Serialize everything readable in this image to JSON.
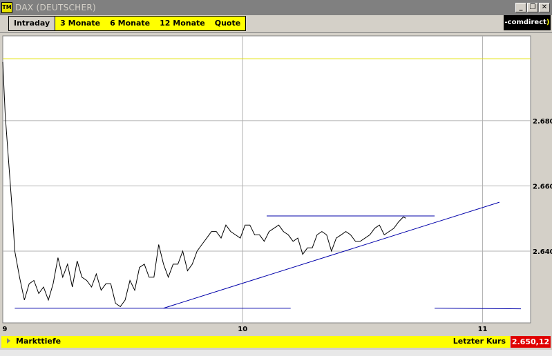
{
  "window": {
    "title": "DAX (DEUTSCHER)",
    "icon_label": "TM",
    "controls": [
      "_",
      "❐",
      "✕"
    ]
  },
  "tabs": [
    {
      "label": "Intraday",
      "active": true
    },
    {
      "label": "3 Monate",
      "active": false
    },
    {
      "label": "6 Monate",
      "active": false
    },
    {
      "label": "12 Monate",
      "active": false
    },
    {
      "label": "Quote",
      "active": false
    }
  ],
  "brand": {
    "name": "comdirect"
  },
  "footer": {
    "markttiefe_label": "Markttiefe",
    "last_price_label": "Letzter Kurs",
    "last_price_value": "2.650,12"
  },
  "colors": {
    "chart_background": "#ffffff",
    "grid": "#b0b0b0",
    "price_line": "#000000",
    "trend_lines": "#0000aa",
    "reference_line": "#e0e000",
    "tabs_yellow": "#ffff00",
    "last_price_red": "#e00000"
  },
  "chart_data": {
    "type": "line",
    "title": "",
    "xlabel": "",
    "ylabel": "",
    "x_ticks": [
      "9",
      "10",
      "11"
    ],
    "y_ticks": [
      "2.640",
      "2.660",
      "2.680"
    ],
    "xlim": [
      9.0,
      11.2
    ],
    "ylim": [
      2618,
      2706
    ],
    "grid": true,
    "y_axis_side": "right",
    "reference_line_y": 2699,
    "series": [
      {
        "x": [
          9.0,
          9.01,
          9.02,
          9.04,
          9.05,
          9.07,
          9.09,
          9.11,
          9.13,
          9.15,
          9.17,
          9.19,
          9.21,
          9.23,
          9.25,
          9.27,
          9.29,
          9.31,
          9.33,
          9.35,
          9.37,
          9.39,
          9.41,
          9.43,
          9.45,
          9.47,
          9.49,
          9.51,
          9.53,
          9.55,
          9.57,
          9.59,
          9.61,
          9.63,
          9.65,
          9.67,
          9.69,
          9.71,
          9.73,
          9.75,
          9.77,
          9.79,
          9.81,
          9.83,
          9.85,
          9.87,
          9.89,
          9.91,
          9.93,
          9.95,
          9.97,
          9.99,
          10.01,
          10.03,
          10.05,
          10.07,
          10.09,
          10.11,
          10.13,
          10.15,
          10.17,
          10.19,
          10.21,
          10.23,
          10.25,
          10.27,
          10.29,
          10.31,
          10.33,
          10.35,
          10.37,
          10.39,
          10.41,
          10.43,
          10.45,
          10.47,
          10.49,
          10.51,
          10.53,
          10.55,
          10.57,
          10.59,
          10.61,
          10.63,
          10.65,
          10.67,
          10.68
        ],
        "y": [
          2698,
          2682,
          2672,
          2652,
          2640,
          2632,
          2625,
          2630,
          2631,
          2627,
          2629,
          2625,
          2630,
          2638,
          2632,
          2636,
          2629,
          2637,
          2632,
          2631,
          2629,
          2633,
          2628,
          2630,
          2630,
          2624,
          2623,
          2625,
          2631,
          2628,
          2635,
          2636,
          2632,
          2632,
          2642,
          2636,
          2632,
          2636,
          2636,
          2640,
          2634,
          2636,
          2640,
          2642,
          2644,
          2646,
          2646,
          2644,
          2648,
          2646,
          2645,
          2644,
          2648,
          2648,
          2645,
          2645,
          2643,
          2646,
          2647,
          2648,
          2646,
          2645,
          2643,
          2644,
          2639,
          2641,
          2641,
          2645,
          2646,
          2645,
          2640,
          2644,
          2645,
          2646,
          2645,
          2643,
          2643,
          2644,
          2645,
          2647,
          2648,
          2645,
          2646,
          2647,
          2649,
          2650.5,
          2650.1
        ]
      }
    ],
    "trend_lines": [
      {
        "x": [
          9.05,
          10.2
        ],
        "y": [
          2622.5,
          2622.5
        ]
      },
      {
        "x": [
          9.67,
          11.07
        ],
        "y": [
          2622.5,
          2655
        ]
      },
      {
        "x": [
          10.1,
          10.8
        ],
        "y": [
          2650.8,
          2650.8
        ]
      },
      {
        "x": [
          10.8,
          11.16
        ],
        "y": [
          2622.5,
          2622.3
        ]
      }
    ]
  }
}
